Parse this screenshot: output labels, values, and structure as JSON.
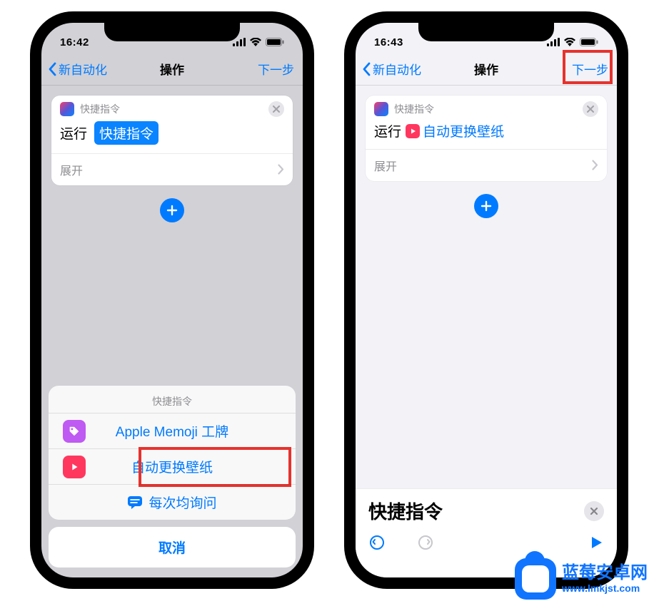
{
  "left": {
    "status_time": "16:42",
    "nav_back": "新自动化",
    "nav_title": "操作",
    "nav_next": "下一步",
    "card": {
      "shortcut_label": "快捷指令",
      "run_text": "运行",
      "run_arg": "快捷指令",
      "expand": "展开"
    },
    "picker": {
      "header": "快捷指令",
      "item1": "Apple Memoji 工牌",
      "item2": "自动更换壁纸",
      "ask_each": "每次均询问",
      "cancel": "取消"
    }
  },
  "right": {
    "status_time": "16:43",
    "nav_back": "新自动化",
    "nav_title": "操作",
    "nav_next": "下一步",
    "card": {
      "shortcut_label": "快捷指令",
      "run_text": "运行",
      "run_arg": "自动更换壁纸",
      "expand": "展开"
    },
    "bottom": {
      "title": "快捷指令"
    }
  },
  "watermark": {
    "line1": "蓝莓安卓网",
    "line2": "www.lmkjst.com"
  }
}
